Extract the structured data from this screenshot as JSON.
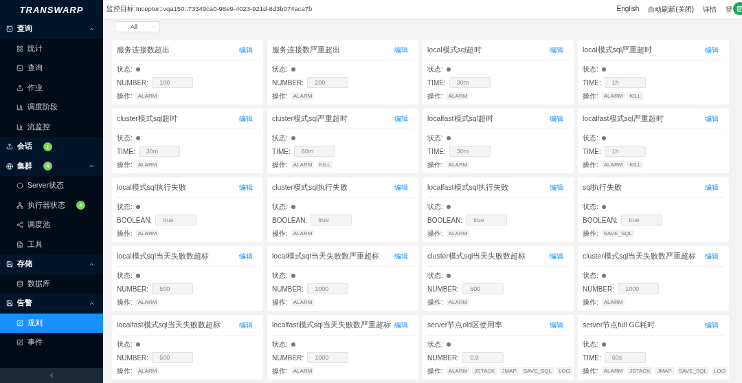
{
  "logo": "TRANSWARP",
  "sidebar": {
    "items": [
      {
        "label": "查询",
        "expanded": true,
        "selected": false,
        "children": [
          {
            "label": "统计",
            "selected": false
          },
          {
            "label": "查询",
            "selected": false
          },
          {
            "label": "作业",
            "selected": false
          },
          {
            "label": "调度阶段",
            "selected": false
          },
          {
            "label": "流监控",
            "selected": false
          }
        ]
      },
      {
        "label": "会话",
        "badge": "1",
        "selected": false
      },
      {
        "label": "集群",
        "badge": "4",
        "expanded": true,
        "selected": false,
        "children": [
          {
            "label": "Server状态",
            "selected": false
          },
          {
            "label": "执行器状态",
            "badge": "4",
            "selected": false
          },
          {
            "label": "调度池",
            "selected": false
          },
          {
            "label": "工具",
            "selected": false
          }
        ]
      },
      {
        "label": "存储",
        "expanded": true,
        "selected": false,
        "children": [
          {
            "label": "数据库",
            "selected": false
          }
        ]
      },
      {
        "label": "告警",
        "expanded": true,
        "selected": false,
        "children": [
          {
            "label": "规则",
            "selected": true
          },
          {
            "label": "事件",
            "selected": false
          }
        ]
      }
    ]
  },
  "header": {
    "title": "监控目标:Inceptor::vqa150::73349ca0-98e9-4023-921d-8d3b074aca7b",
    "links": [
      "English",
      "自动刷新(关闭)",
      "详情",
      "登"
    ]
  },
  "filter": {
    "value": "All"
  },
  "rules": [
    {
      "title": "服务连接数超出",
      "edit": "编辑",
      "status_label": "状态:",
      "field_label": "NUMBER:",
      "value": "100",
      "ops_label": "操作:",
      "ops": [
        "ALARM"
      ]
    },
    {
      "title": "服务连接数严重超出",
      "edit": "编辑",
      "status_label": "状态:",
      "field_label": "NUMBER:",
      "value": "200",
      "ops_label": "操作:",
      "ops": [
        "ALARM"
      ]
    },
    {
      "title": "local模式sql超时",
      "edit": "编辑",
      "status_label": "状态:",
      "field_label": "TIME:",
      "value": "30m",
      "ops_label": "操作:",
      "ops": [
        "ALARM"
      ]
    },
    {
      "title": "local模式sql严重超时",
      "edit": "编辑",
      "status_label": "状态:",
      "field_label": "TIME:",
      "value": "1h",
      "ops_label": "操作:",
      "ops": [
        "ALARM",
        "KILL"
      ]
    },
    {
      "title": "cluster模式sql超时",
      "edit": "编辑",
      "status_label": "状态:",
      "field_label": "TIME:",
      "value": "30m",
      "ops_label": "操作:",
      "ops": [
        "ALARM"
      ]
    },
    {
      "title": "cluster模式sql严重超时",
      "edit": "编辑",
      "status_label": "状态:",
      "field_label": "TIME:",
      "value": "60m",
      "ops_label": "操作:",
      "ops": [
        "ALARM",
        "KILL"
      ]
    },
    {
      "title": "localfast模式sql超时",
      "edit": "编辑",
      "status_label": "状态:",
      "field_label": "TIME:",
      "value": "30m",
      "ops_label": "操作:",
      "ops": [
        "ALARM"
      ]
    },
    {
      "title": "localfast模式sql严重超时",
      "edit": "编辑",
      "status_label": "状态:",
      "field_label": "TIME:",
      "value": "1h",
      "ops_label": "操作:",
      "ops": [
        "ALARM",
        "KILL"
      ]
    },
    {
      "title": "local模式sql执行失败",
      "edit": "编辑",
      "status_label": "状态:",
      "field_label": "BOOLEAN:",
      "value": "true",
      "ops_label": "操作:",
      "ops": [
        "ALARM"
      ]
    },
    {
      "title": "cluster模式sql执行失败",
      "edit": "编辑",
      "status_label": "状态:",
      "field_label": "BOOLEAN:",
      "value": "true",
      "ops_label": "操作:",
      "ops": [
        "ALARM"
      ]
    },
    {
      "title": "localfast模式sql执行失败",
      "edit": "编辑",
      "status_label": "状态:",
      "field_label": "BOOLEAN:",
      "value": "true",
      "ops_label": "操作:",
      "ops": [
        "ALARM"
      ]
    },
    {
      "title": "sql执行失败",
      "edit": "编辑",
      "status_label": "状态:",
      "field_label": "BOOLEAN:",
      "value": "true",
      "ops_label": "操作:",
      "ops": [
        "SAVE_SQL"
      ]
    },
    {
      "title": "local模式sql当天失败数超标",
      "edit": "编辑",
      "status_label": "状态:",
      "field_label": "NUMBER:",
      "value": "500",
      "ops_label": "操作:",
      "ops": [
        "ALARM"
      ]
    },
    {
      "title": "local模式sql当天失败数严重超标",
      "edit": "编辑",
      "status_label": "状态:",
      "field_label": "NUMBER:",
      "value": "1000",
      "ops_label": "操作:",
      "ops": [
        "ALARM"
      ]
    },
    {
      "title": "cluster模式sql当天失败数超标",
      "edit": "编辑",
      "status_label": "状态:",
      "field_label": "NUMBER:",
      "value": "500",
      "ops_label": "操作:",
      "ops": [
        "ALARM"
      ]
    },
    {
      "title": "cluster模式sql当天失败数严重超标",
      "edit": "编辑",
      "status_label": "状态:",
      "field_label": "NUMBER:",
      "value": "1000",
      "ops_label": "操作:",
      "ops": [
        "ALARM"
      ]
    },
    {
      "title": "localfast模式sql当天失败数超标",
      "edit": "编辑",
      "status_label": "状态:",
      "field_label": "NUMBER:",
      "value": "500",
      "ops_label": "操作:",
      "ops": [
        "ALARM"
      ]
    },
    {
      "title": "localfast模式sql当天失败数严重超标",
      "edit": "编辑",
      "status_label": "状态:",
      "field_label": "NUMBER:",
      "value": "1000",
      "ops_label": "操作:",
      "ops": [
        "ALARM"
      ]
    },
    {
      "title": "server节点old区使用率",
      "edit": "编辑",
      "status_label": "状态:",
      "field_label": "NUMBER:",
      "value": "0.9",
      "ops_label": "操作:",
      "ops": [
        "ALARM",
        "JSTACK",
        "JMAP",
        "SAVE_SQL",
        "LOG"
      ]
    },
    {
      "title": "server节点full GC耗时",
      "edit": "编辑",
      "status_label": "状态:",
      "field_label": "TIME:",
      "value": "60s",
      "ops_label": "操作:",
      "ops": [
        "ALARM",
        "JSTACK",
        "JMAP",
        "SAVE_SQL",
        "LOG"
      ]
    }
  ]
}
